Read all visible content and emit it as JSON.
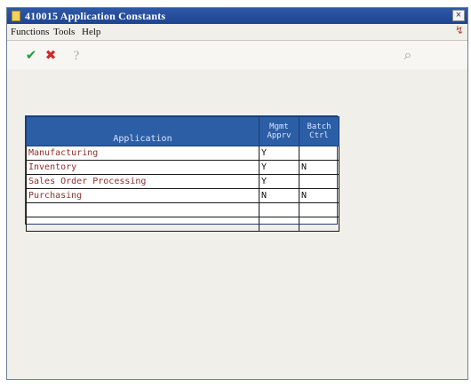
{
  "window": {
    "title": "410015  Application Constants",
    "close_label": "×"
  },
  "menu": [
    "Functions",
    "Tools",
    "Help"
  ],
  "toolbar": {
    "ok_icon": "checkmark-icon",
    "cancel_icon": "cancel-icon",
    "help_icon": "help-icon",
    "search_icon": "search-icon"
  },
  "table": {
    "headers": [
      "Application",
      "Mgmt Apprv",
      "Batch Ctrl"
    ],
    "rows": [
      [
        "Manufacturing",
        "Y",
        ""
      ],
      [
        "Inventory",
        "Y",
        "N"
      ],
      [
        "Sales Order Processing",
        "Y",
        ""
      ],
      [
        "Purchasing",
        "N",
        "N"
      ],
      [
        "",
        "",
        ""
      ],
      [
        "",
        "",
        ""
      ]
    ]
  }
}
